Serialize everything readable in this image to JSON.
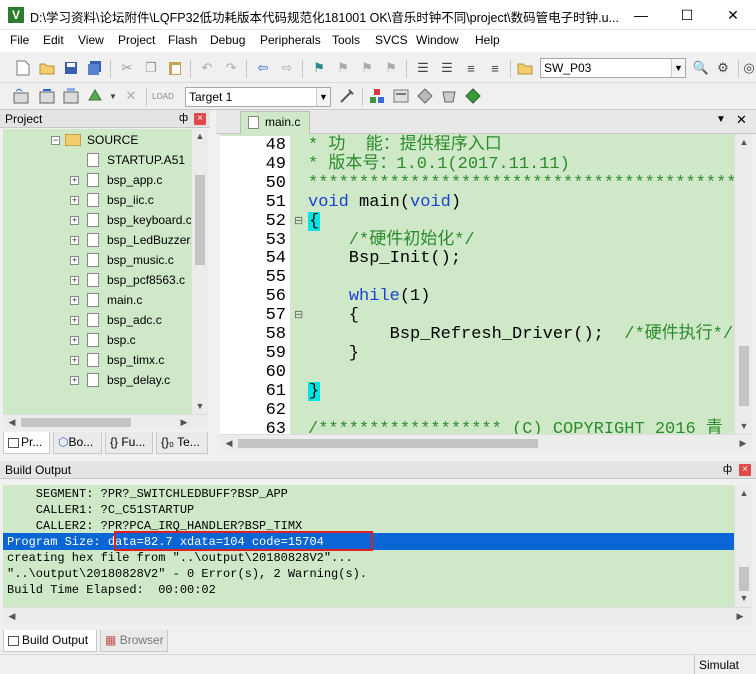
{
  "window": {
    "title": "D:\\学习资料\\论坛附件\\LQFP32低功耗版本代码规范化181001 OK\\音乐时钟不同\\project\\数码管电子时钟.u...",
    "minimize": "—",
    "maximize": "☐",
    "close": "✕"
  },
  "menu": [
    "File",
    "Edit",
    "View",
    "Project",
    "Flash",
    "Debug",
    "Peripherals",
    "Tools",
    "SVCS",
    "Window",
    "Help"
  ],
  "toolbar": {
    "find_combo": "SW_P03",
    "target_combo": "Target 1"
  },
  "project_panel": {
    "title": "Project",
    "pin": "ф",
    "close": "×",
    "folder": "SOURCE",
    "files": [
      "STARTUP.A51",
      "bsp_app.c",
      "bsp_iic.c",
      "bsp_keyboard.c",
      "bsp_LedBuzzer.c",
      "bsp_music.c",
      "bsp_pcf8563.c",
      "main.c",
      "bsp_adc.c",
      "bsp.c",
      "bsp_timx.c",
      "bsp_delay.c"
    ],
    "tabs": [
      "Pr...",
      "Bo...",
      "{} Fu...",
      "{}₀ Te..."
    ]
  },
  "editor": {
    "tab": "main.c",
    "lines": [
      {
        "num": "48",
        "text": "* 功  能：提供程序入口",
        "cls": "cm",
        "mark": ""
      },
      {
        "num": "49",
        "text": "* 版本号：1.0.1(2017.11.11)",
        "cls": "cm",
        "mark": ""
      },
      {
        "num": "50",
        "text": "*******************************************",
        "cls": "cm",
        "mark": ""
      },
      {
        "num": "51",
        "text": "void main(void)",
        "cls": "mix-main",
        "mark": ""
      },
      {
        "num": "52",
        "text": "{",
        "cls": "brace",
        "mark": "⊟"
      },
      {
        "num": "53",
        "text": "    /*硬件初始化*/",
        "cls": "cm",
        "mark": ""
      },
      {
        "num": "54",
        "text": "    Bsp_Init();",
        "cls": "",
        "mark": ""
      },
      {
        "num": "55",
        "text": "",
        "cls": "",
        "mark": ""
      },
      {
        "num": "56",
        "text": "    while(1)",
        "cls": "mix-while",
        "mark": ""
      },
      {
        "num": "57",
        "text": "    {",
        "cls": "",
        "mark": "⊟"
      },
      {
        "num": "58",
        "text": "        Bsp_Refresh_Driver();  /*硬件执行*/",
        "cls": "mix-call",
        "mark": ""
      },
      {
        "num": "59",
        "text": "    }",
        "cls": "",
        "mark": ""
      },
      {
        "num": "60",
        "text": "",
        "cls": "",
        "mark": ""
      },
      {
        "num": "61",
        "text": "}",
        "cls": "brace",
        "mark": ""
      },
      {
        "num": "62",
        "text": "",
        "cls": "",
        "mark": ""
      },
      {
        "num": "63",
        "text": "/****************** (C) COPYRIGHT 2016 青",
        "cls": "cm",
        "mark": ""
      }
    ]
  },
  "build_panel": {
    "title": "Build Output",
    "pin": "ф",
    "close": "×",
    "lines": [
      "    SEGMENT: ?PR?_SWITCHLEDBUFF?BSP_APP",
      "    CALLER1: ?C_C51STARTUP",
      "    CALLER2: ?PR?PCA_IRQ_HANDLER?BSP_TIMX",
      "Program Size: data=82.7 xdata=104 code=15704",
      "creating hex file from \"..\\output\\20180828V2\"...",
      "\"..\\output\\20180828V2\" - 0 Error(s), 2 Warning(s).",
      "Build Time Elapsed:  00:00:02"
    ],
    "tabs": [
      "Build Output",
      "Browser"
    ]
  },
  "status": {
    "right": "Simulat"
  },
  "colors": {
    "code_bg": "#cfe8c8",
    "selection": "#0a66d4",
    "highlight_box": "#e02020"
  }
}
